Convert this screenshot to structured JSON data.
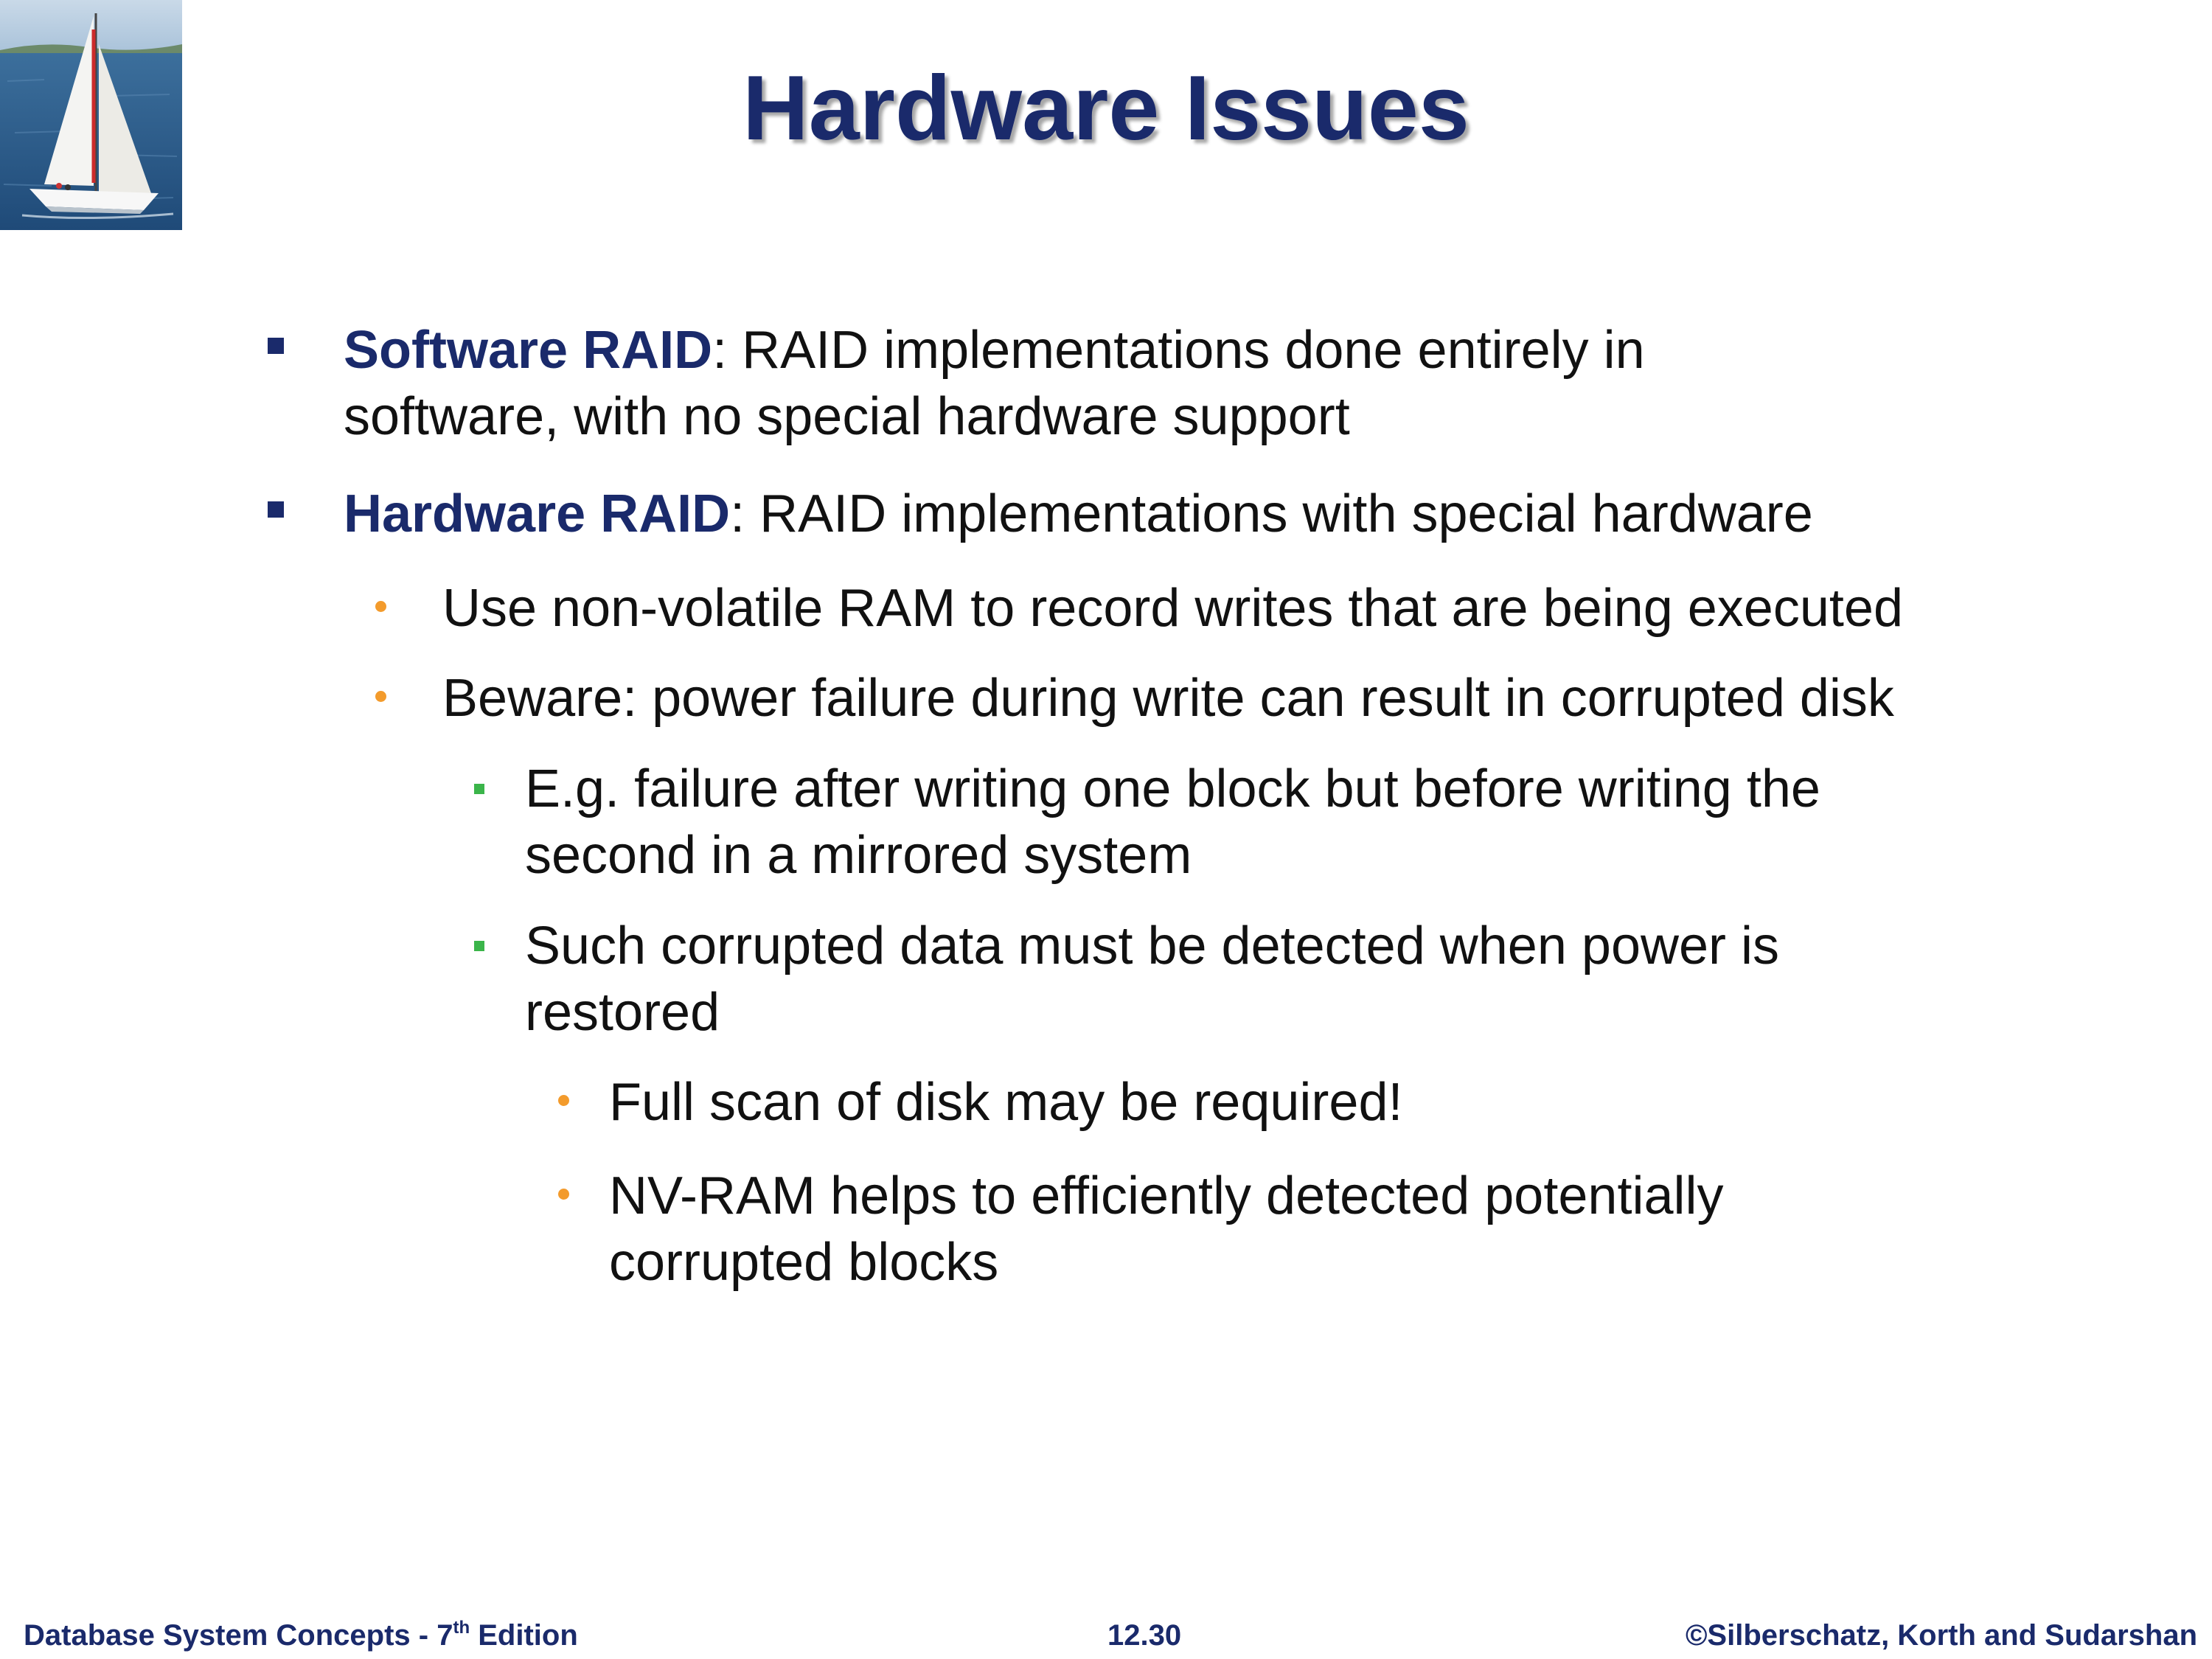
{
  "slide": {
    "title": "Hardware Issues"
  },
  "bullets": {
    "software_raid": {
      "term": "Software RAID",
      "text_line1": ":  RAID implementations done entirely in",
      "text_line2": "software, with no special hardware support"
    },
    "hardware_raid": {
      "term": "Hardware RAID",
      "text": ":  RAID implementations with special hardware"
    },
    "nvram_record": "Use non-volatile RAM to record writes that are being executed",
    "beware": "Beware:  power failure during write can result in corrupted disk",
    "example": {
      "line1": "E.g. failure after writing one block but before writing the",
      "line2": "second in a mirrored system"
    },
    "detect": {
      "line1": "Such corrupted data must be detected when power is",
      "line2": "restored"
    },
    "full_scan": "Full scan of disk may be required!",
    "nvram_helps": {
      "line1": "NV-RAM helps to efficiently detected potentially",
      "line2": "corrupted blocks"
    }
  },
  "footer": {
    "book": "Database System Concepts - 7",
    "edition_sup": "th",
    "edition": " Edition",
    "page_number": "12.30",
    "copyright": "©Silberschatz, Korth and Sudarshan"
  },
  "colors": {
    "title": "#1a2a6b",
    "term": "#1a2a6b",
    "level1_bullet": "#1a2a6b",
    "level2_bullet": "#f39b2c",
    "level3_bullet": "#3bb54a",
    "footer": "#1a2a6b"
  },
  "icons": {
    "logo": "sailboat-image"
  }
}
